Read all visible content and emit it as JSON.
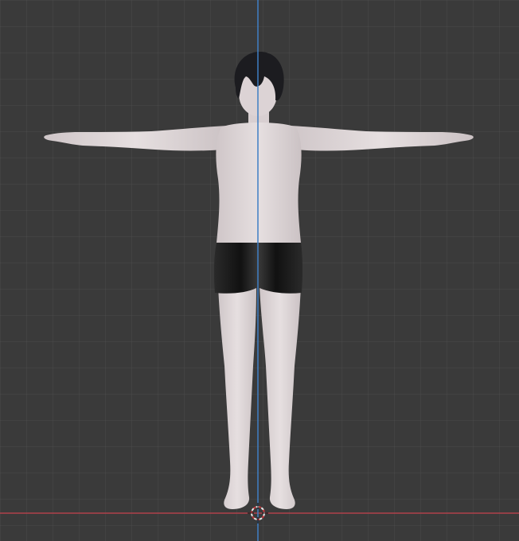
{
  "viewport": {
    "view": "front-orthographic",
    "background_color": "#3a3a3a",
    "grid_color": "#4a4a4a",
    "z_axis_color": "#3f7fc4",
    "x_axis_color": "#b0414a",
    "cursor_icon": "3d-cursor-icon"
  },
  "model": {
    "pose": "t-pose",
    "skin_color": "#ddd5d6",
    "hair_color": "#1c1c20",
    "shorts_color": "#1a1a1a"
  }
}
